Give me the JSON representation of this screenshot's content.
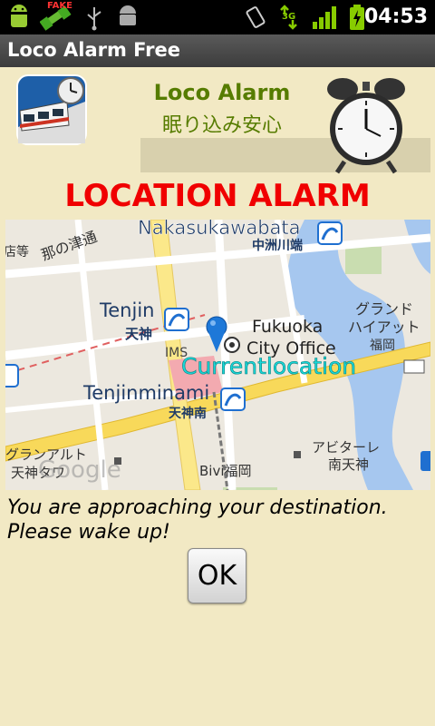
{
  "status_bar": {
    "time": "04:53",
    "network": "3G",
    "fake_label": "FAKE"
  },
  "app": {
    "title": "Loco Alarm Free"
  },
  "header": {
    "title": "Loco Alarm",
    "subtitle": "眠り込み安心"
  },
  "alarm": {
    "heading": "LOCATION ALARM",
    "message_line1": "You are approaching your destination.",
    "message_line2": "Please wake up!",
    "ok_label": "OK"
  },
  "map": {
    "labels": {
      "nakasukawabata": "Nakasukawabata",
      "nakasukawabata_jp": "中洲川端",
      "tsuyu": "那の津通",
      "hakata_ko": "店等",
      "tenjin": "Tenjin",
      "tenjin_jp": "天神",
      "ims": "IMS",
      "fukuoka": "Fukuoka",
      "city_office": "City Office",
      "grand_hyatt_1": "グランド",
      "grand_hyatt_2": "ハイアット",
      "grand_hyatt_3": "福岡",
      "tenjinminami": "Tenjinminami",
      "tenjinminami_jp": "天神南",
      "current_location": "Currentlocation",
      "abitare": "アビターレ",
      "minami_tenjin": "南天神",
      "granalto": "グランアルト",
      "tenjin_tower": "天神タワ",
      "bivi": "Bivi福岡",
      "google": "Google"
    }
  }
}
